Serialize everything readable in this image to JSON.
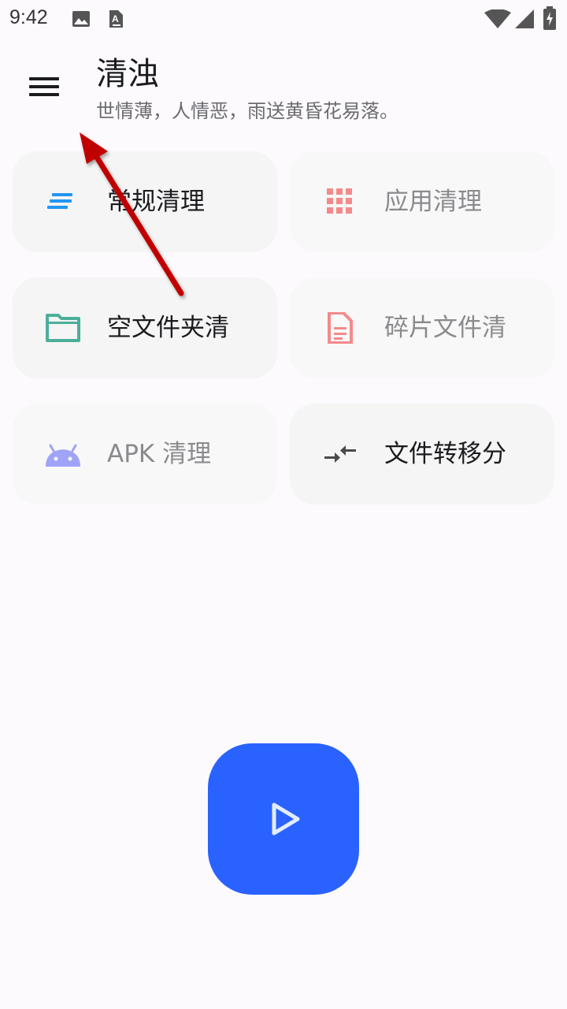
{
  "status_bar": {
    "time": "9:42",
    "icons": [
      "image-icon",
      "accessibility-a-icon",
      "wifi-icon",
      "signal-icon",
      "battery-charging-icon"
    ]
  },
  "header": {
    "title": "清浊",
    "subtitle": "世情薄，人情恶，雨送黄昏花易落。",
    "menu_icon": "hamburger-menu-icon"
  },
  "cards": [
    {
      "label": "常规清理",
      "icon": "lines-icon",
      "color": "#2196f3",
      "enabled": true
    },
    {
      "label": "应用清理",
      "icon": "apps-grid-icon",
      "color": "#f48a8a",
      "enabled": false
    },
    {
      "label": "空文件夹清",
      "icon": "folder-icon",
      "color": "#4caf9a",
      "enabled": true
    },
    {
      "label": "碎片文件清",
      "icon": "document-icon",
      "color": "#f48a8a",
      "enabled": false
    },
    {
      "label": "APK 清理",
      "icon": "android-icon",
      "color": "#9fa4f7",
      "enabled": false
    },
    {
      "label": "文件转移分",
      "icon": "compare-arrows-icon",
      "color": "#4a4a4a",
      "enabled": true
    }
  ],
  "fab": {
    "icon": "play-icon",
    "color": "#2962ff"
  },
  "annotation": {
    "color": "#c00000"
  }
}
